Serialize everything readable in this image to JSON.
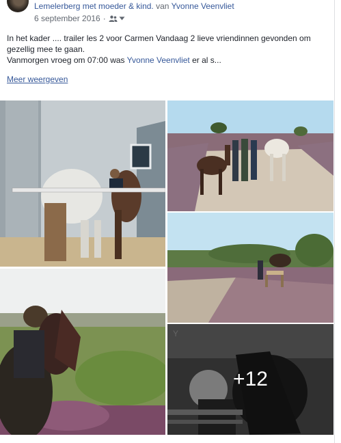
{
  "post": {
    "group_name": "Lemelerberg met moeder & kind.",
    "by_text": "van",
    "author_name": "Yvonne Veenvliet",
    "date": "6 september 2016",
    "separator": "·",
    "text_line1": "In het kader .... trailer les 2 voor Carmen Vandaag 2 lieve vriendinnen gevonden om gezellig mee te gaan.",
    "text_line2_prefix": "Vanmorgen vroeg om 07:00 was",
    "text_line2_mention": "Yvonne Veenvliet",
    "text_line2_suffix": "er al s...",
    "see_more": "Meer weergeven"
  },
  "photos": {
    "more_count": "+12"
  },
  "icons": {
    "audience": "group-icon",
    "dropdown": "chevron-down-icon"
  },
  "colors": {
    "link": "#365899",
    "meta": "#616770",
    "text": "#1d2129"
  }
}
